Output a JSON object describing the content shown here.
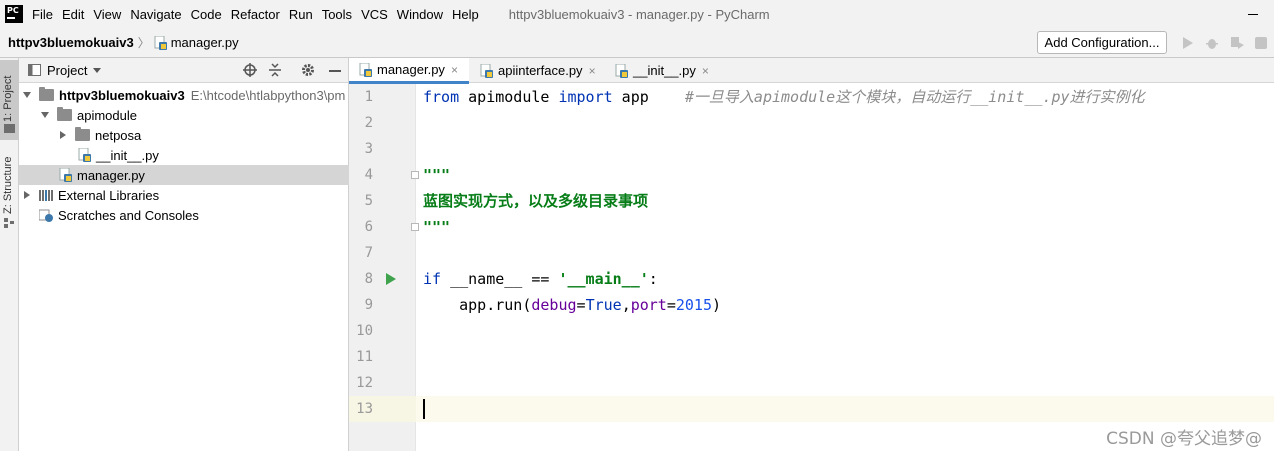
{
  "app": {
    "logo_text": "PC",
    "window_title": "httpv3bluemokuaiv3 - manager.py - PyCharm"
  },
  "menu": {
    "items": [
      "File",
      "Edit",
      "View",
      "Navigate",
      "Code",
      "Refactor",
      "Run",
      "Tools",
      "VCS",
      "Window",
      "Help"
    ]
  },
  "navbar": {
    "project": "httpv3bluemokuaiv3",
    "file": "manager.py",
    "add_configuration": "Add Configuration..."
  },
  "left_strip": {
    "project_label": "1: Project",
    "structure_label": "Z: Structure"
  },
  "project_panel": {
    "title": "Project",
    "tree": [
      {
        "label": "httpv3bluemokuaiv3",
        "path": "E:\\htcode\\htlabpython3\\pm",
        "bold": true
      },
      {
        "label": "apimodule"
      },
      {
        "label": "netposa"
      },
      {
        "label": "__init__.py"
      },
      {
        "label": "manager.py",
        "selected": true
      },
      {
        "label": "External Libraries"
      },
      {
        "label": "Scratches and Consoles"
      }
    ]
  },
  "editor": {
    "tabs": [
      {
        "label": "manager.py",
        "active": true
      },
      {
        "label": "apiinterface.py",
        "active": false
      },
      {
        "label": "__init__.py",
        "active": false
      }
    ],
    "line_numbers": [
      "1",
      "2",
      "3",
      "4",
      "5",
      "6",
      "7",
      "8",
      "9",
      "10",
      "11",
      "12",
      "13"
    ],
    "code": {
      "l1_from": "from",
      "l1_module": " apimodule ",
      "l1_import": "import",
      "l1_app": " app    ",
      "l1_comment": "#一旦导入apimodule这个模块，自动运行__init__.py进行实例化",
      "l4": "\"\"\"",
      "l5": "蓝图实现方式，以及多级目录事项",
      "l6": "\"\"\"",
      "l8_if": "if",
      "l8_name": " __name__ == ",
      "l8_str": "'__main__'",
      "l8_colon": ":",
      "l9_call": "    app.run(",
      "l9_debug": "debug",
      "l9_eq1": "=",
      "l9_true": "True",
      "l9_comma": ",",
      "l9_port": "port",
      "l9_eq2": "=",
      "l9_num": "2015",
      "l9_close": ")"
    }
  },
  "watermark": "CSDN @夸父追梦@",
  "colors": {
    "keyword": "#0033b3",
    "comment": "#8c8c8c",
    "string": "#067d17",
    "param": "#660099",
    "number": "#1750eb",
    "active_tab_underline": "#4083c9",
    "run_icon": "#3fa34d"
  }
}
